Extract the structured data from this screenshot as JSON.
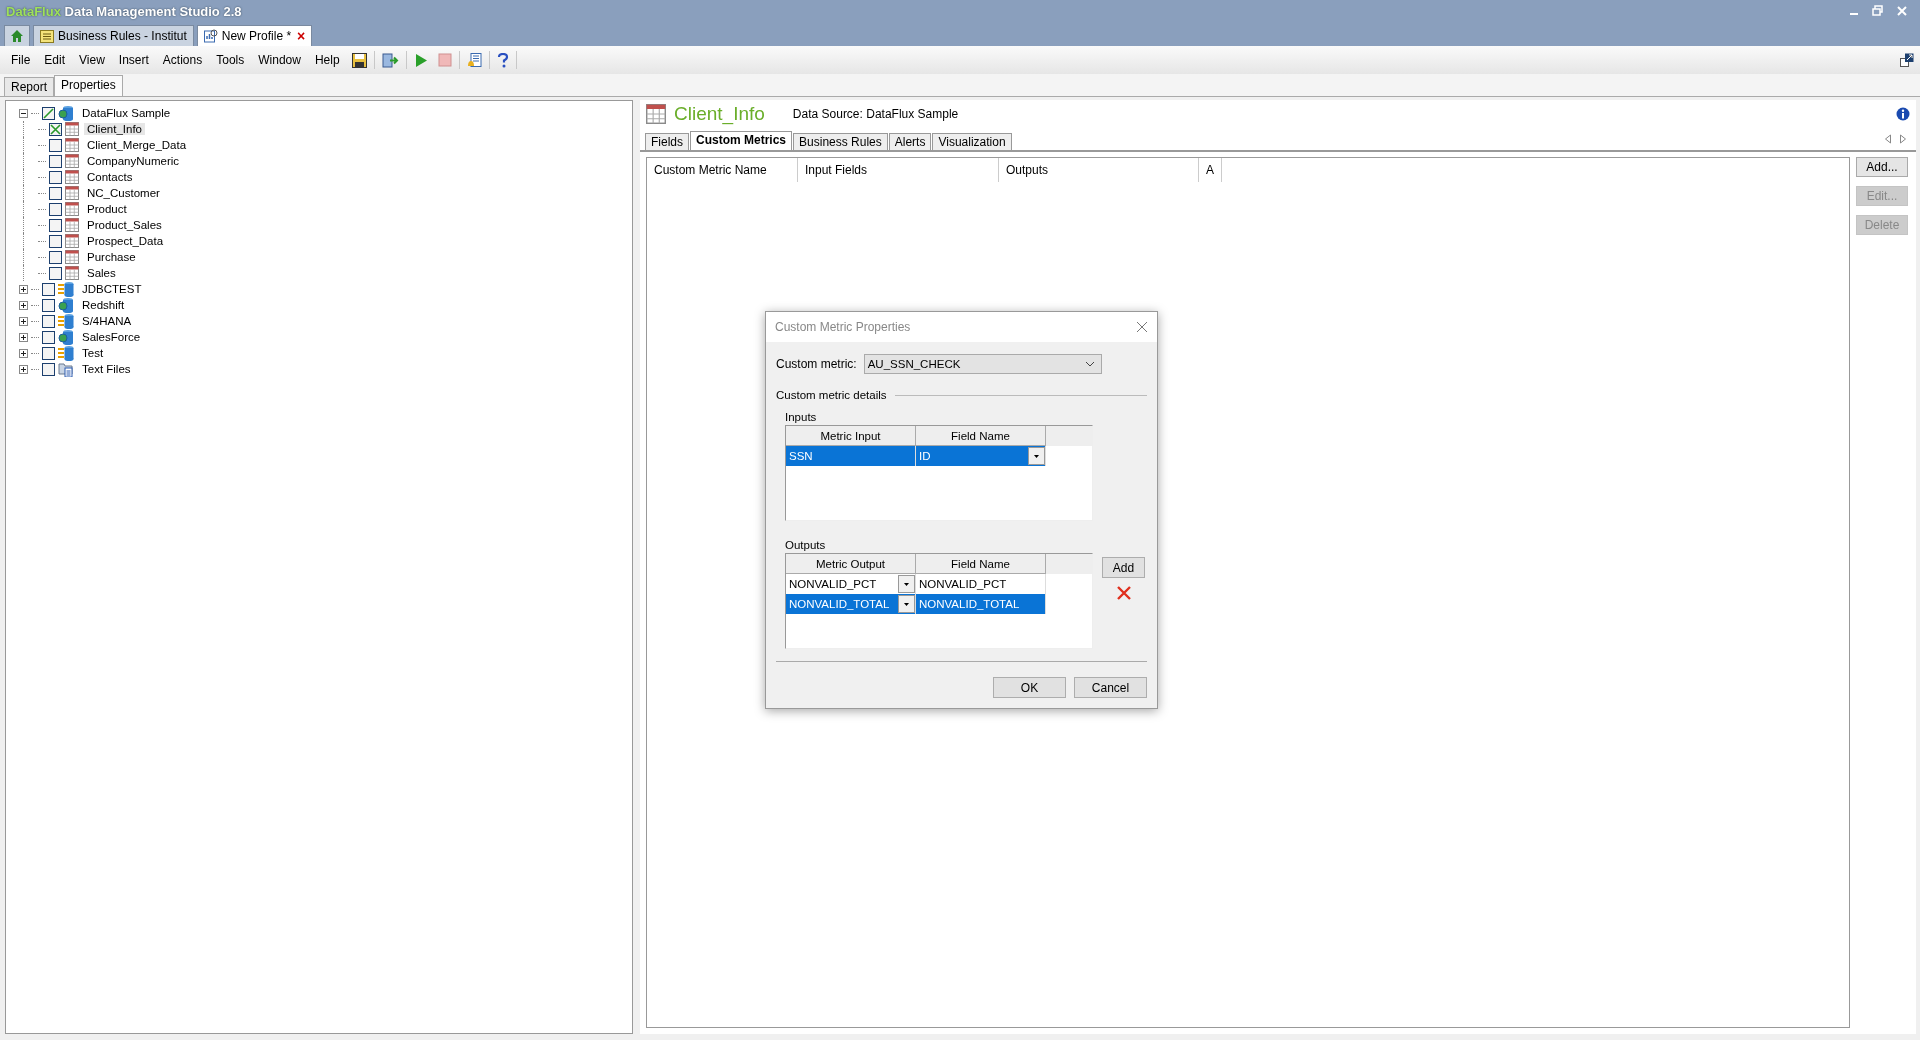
{
  "app_title": {
    "brand": "DataFlux",
    "name": "Data Management Studio 2.8"
  },
  "doc_tabs": [
    {
      "label": "Business Rules - Institut",
      "selected": false,
      "closable": false,
      "kind": "rules"
    },
    {
      "label": "New Profile *",
      "selected": true,
      "closable": true,
      "kind": "profile"
    }
  ],
  "close_mark": "×",
  "menu": [
    "File",
    "Edit",
    "View",
    "Insert",
    "Actions",
    "Tools",
    "Window",
    "Help"
  ],
  "panel_tabs": [
    {
      "label": "Report",
      "selected": false
    },
    {
      "label": "Properties",
      "selected": true
    }
  ],
  "tree": [
    {
      "label": "DataFlux Sample",
      "kind": "odbc",
      "checked": false,
      "partial": true,
      "expanded": true,
      "children": [
        {
          "label": "Client_Info",
          "checked": true,
          "selected": true
        },
        {
          "label": "Client_Merge_Data",
          "checked": false,
          "selected": false
        },
        {
          "label": "CompanyNumeric",
          "checked": false,
          "selected": false
        },
        {
          "label": "Contacts",
          "checked": false,
          "selected": false
        },
        {
          "label": "NC_Customer",
          "checked": false,
          "selected": false
        },
        {
          "label": "Product",
          "checked": false,
          "selected": false
        },
        {
          "label": "Product_Sales",
          "checked": false,
          "selected": false
        },
        {
          "label": "Prospect_Data",
          "checked": false,
          "selected": false
        },
        {
          "label": "Purchase",
          "checked": false,
          "selected": false
        },
        {
          "label": "Sales",
          "checked": false,
          "selected": false
        }
      ]
    },
    {
      "label": "JDBCTEST",
      "kind": "jdbc",
      "checked": false,
      "partial": false,
      "expanded": false
    },
    {
      "label": "Redshift",
      "kind": "odbc",
      "checked": false,
      "partial": false,
      "expanded": false
    },
    {
      "label": "S/4HANA",
      "kind": "jdbc",
      "checked": false,
      "partial": false,
      "expanded": false
    },
    {
      "label": "SalesForce",
      "kind": "odbc",
      "checked": false,
      "partial": false,
      "expanded": false
    },
    {
      "label": "Test",
      "kind": "jdbc",
      "checked": false,
      "partial": false,
      "expanded": false
    },
    {
      "label": "Text Files",
      "kind": "files",
      "checked": false,
      "partial": false,
      "expanded": false
    }
  ],
  "header": {
    "title": "Client_Info",
    "data_source": "Data Source: DataFlux Sample"
  },
  "tabs": [
    {
      "label": "Fields",
      "selected": false
    },
    {
      "label": "Custom Metrics",
      "selected": true
    },
    {
      "label": "Business Rules",
      "selected": false
    },
    {
      "label": "Alerts",
      "selected": false
    },
    {
      "label": "Visualization",
      "selected": false
    }
  ],
  "table": {
    "columns": [
      "Custom Metric Name",
      "Input Fields",
      "Outputs",
      "A"
    ]
  },
  "side_buttons": [
    {
      "label": "Add...",
      "disabled": false
    },
    {
      "label": "Edit...",
      "disabled": true
    },
    {
      "label": "Delete",
      "disabled": true
    }
  ],
  "dialog": {
    "title": "Custom Metric Properties",
    "metric_label": "Custom metric:",
    "metric_value": "AU_SSN_CHECK",
    "details_label": "Custom metric details",
    "inputs": {
      "label": "Inputs",
      "columns": [
        {
          "label": "Metric Input",
          "kind": "text"
        },
        {
          "label": "Field Name",
          "kind": "dropdown"
        }
      ],
      "rows": [
        {
          "cells": [
            "SSN",
            "ID"
          ],
          "selected": true
        }
      ]
    },
    "outputs": {
      "label": "Outputs",
      "columns": [
        {
          "label": "Metric Output",
          "kind": "dropdown"
        },
        {
          "label": "Field Name",
          "kind": "text"
        }
      ],
      "rows": [
        {
          "cells": [
            "NONVALID_PCT",
            "NONVALID_PCT"
          ],
          "selected": false
        },
        {
          "cells": [
            "NONVALID_TOTAL",
            "NONVALID_TOTAL"
          ],
          "selected": true
        }
      ]
    },
    "add_label": "Add",
    "ok": "OK",
    "cancel": "Cancel"
  }
}
